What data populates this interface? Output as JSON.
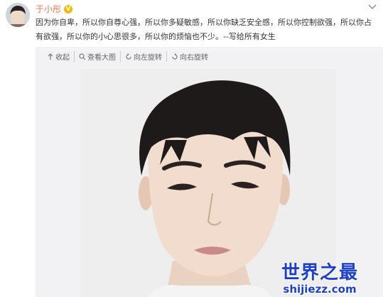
{
  "post": {
    "username": "于小彤",
    "verified_badge": "V",
    "text": "因为你自卑，所以你自尊心强，所以你多疑敏感，所以你缺乏安全感，所以你控制欲强，所以你占有欲强，所以你的小心思很多，所以你的烦恼也不少。--写给所有女生"
  },
  "toolbar": {
    "collapse_label": "收起",
    "view_large_label": "查看大图",
    "rotate_left_label": "向左旋转",
    "rotate_right_label": "向右旋转"
  },
  "watermark": {
    "title": "世界之最",
    "url": "shijiezz.com"
  },
  "colors": {
    "username": "#eb7350",
    "panel_bg": "#f2f2f5",
    "watermark": "#1d3fd0"
  }
}
